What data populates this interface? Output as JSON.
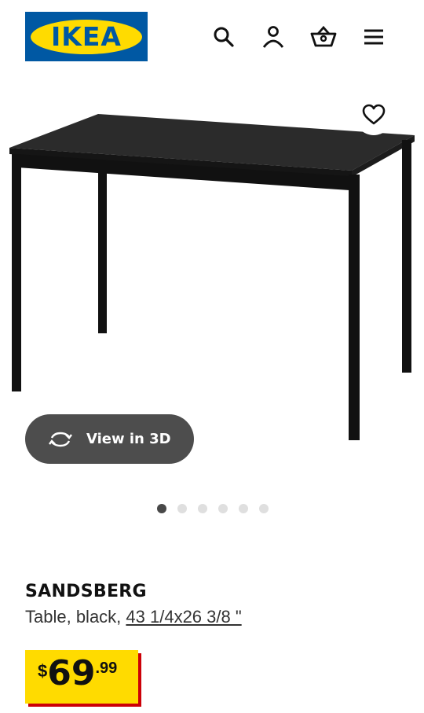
{
  "header": {
    "logo_text": "IKEA",
    "icons": [
      "search-icon",
      "account-icon",
      "basket-icon",
      "menu-icon"
    ]
  },
  "gallery": {
    "image_alt": "table-image",
    "favourite_icon": "heart-icon",
    "view3d_label": "View in 3D",
    "view3d_icon": "rotate-icon",
    "dots_total": 6,
    "dots_active_index": 0
  },
  "product": {
    "name": "SANDSBERG",
    "description_prefix": "Table, black, ",
    "dimensions_link": "43 1/4x26 3/8 \"",
    "price": {
      "currency": "$",
      "integer": "69",
      "decimal": ".99"
    }
  },
  "colors": {
    "ikea_blue": "#0058a3",
    "ikea_yellow": "#ffdb00",
    "price_accent_red": "#cc0008",
    "button_dark": "#4d4d4d"
  }
}
